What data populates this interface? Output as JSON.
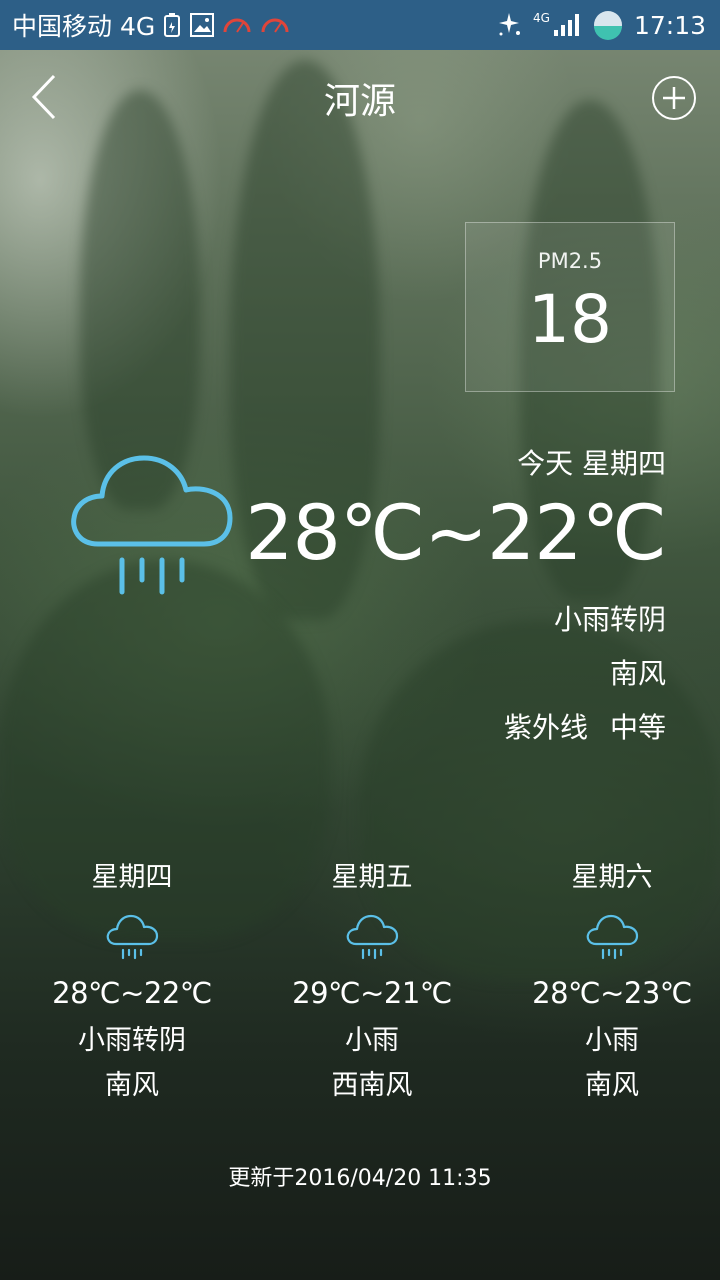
{
  "status_bar": {
    "carrier": "中国移动 4G",
    "network_badge": "4G",
    "time": "17:13"
  },
  "header": {
    "city": "河源"
  },
  "pm25": {
    "label": "PM2.5",
    "value": "18"
  },
  "today": {
    "day_label": "今天  星期四",
    "temp_range": "28℃~22℃",
    "condition": "小雨转阴",
    "wind": "南风",
    "uv_label": "紫外线",
    "uv_value": "中等",
    "icon": "rain-cloud-icon"
  },
  "forecast": [
    {
      "day": "星期四",
      "temp": "28℃~22℃",
      "condition": "小雨转阴",
      "wind": "南风",
      "icon": "rain-cloud-icon"
    },
    {
      "day": "星期五",
      "temp": "29℃~21℃",
      "condition": "小雨",
      "wind": "西南风",
      "icon": "rain-cloud-icon"
    },
    {
      "day": "星期六",
      "temp": "28℃~23℃",
      "condition": "小雨",
      "wind": "南风",
      "icon": "rain-cloud-icon"
    }
  ],
  "updated": "更新于2016/04/20 11:35",
  "colors": {
    "status_bar": "#2d5f87",
    "icon_accent": "#5bc0e8",
    "text": "#ffffff"
  }
}
